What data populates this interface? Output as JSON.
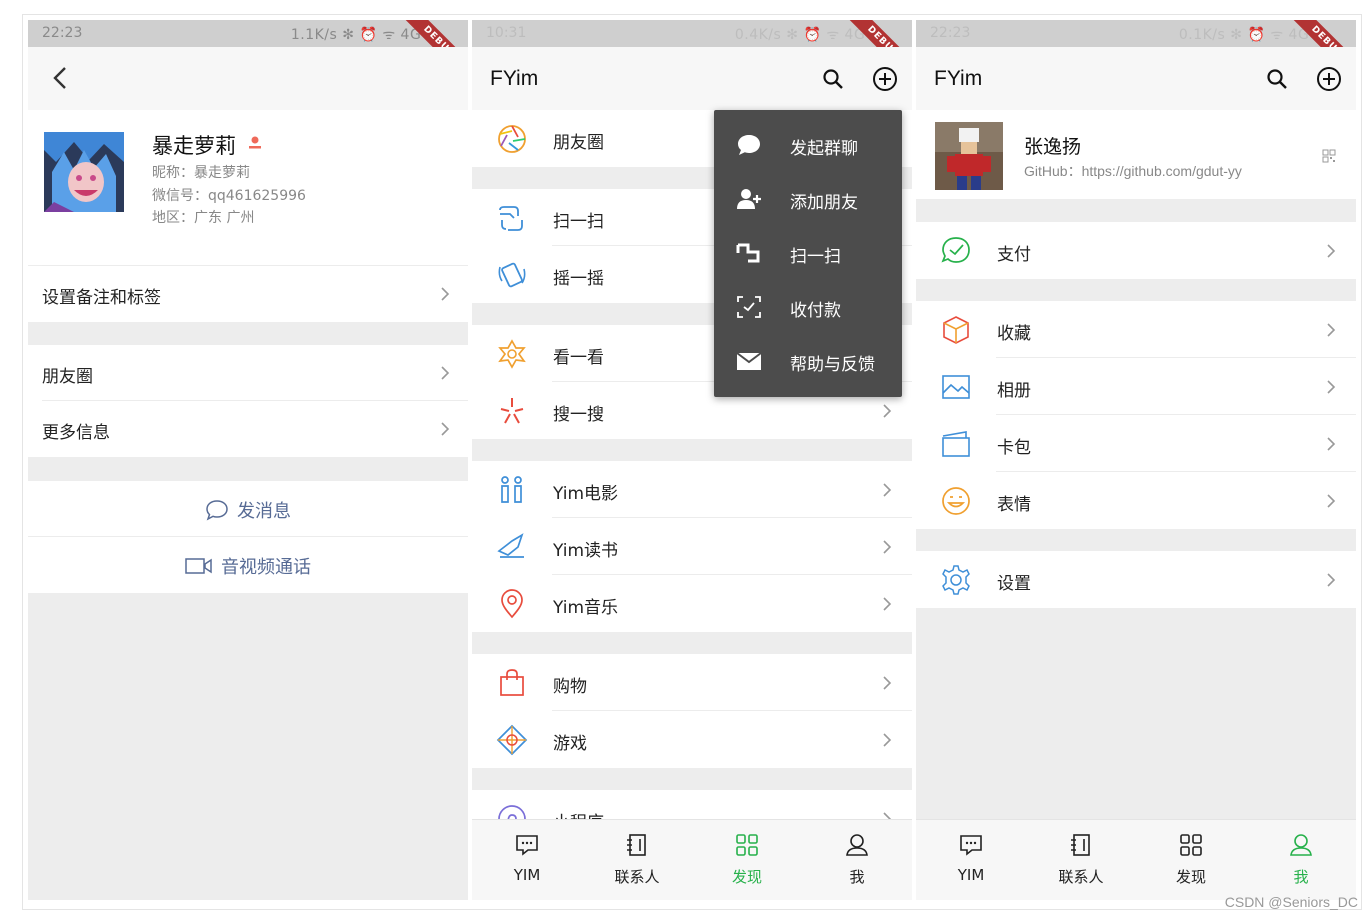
{
  "screen1": {
    "status_time": "22:23",
    "status_net": "1.1K/s ✻ ⏰ ᯤ 4G ▭",
    "debug_badge": "DEBUG",
    "profile": {
      "name": "暴走萝莉",
      "nickname": "昵称：暴走萝莉",
      "wechat_id": "微信号：qq461625996",
      "region": "地区：广东 广州"
    },
    "rows": {
      "remark": "设置备注和标签",
      "moments": "朋友圈",
      "more_info": "更多信息"
    },
    "actions": {
      "send_message": "发消息",
      "video_call": "音视频通话"
    }
  },
  "screen2": {
    "status_time": "10:31",
    "status_net": "0.4K/s ✻ ⏰ ᯤ 4G ▭",
    "debug_badge": "DEBUG",
    "app_title": "FYim",
    "items": {
      "moments": "朋友圈",
      "scan": "扫一扫",
      "shake": "摇一摇",
      "look": "看一看",
      "search": "搜一搜",
      "movie": "Yim电影",
      "books": "Yim读书",
      "music": "Yim音乐",
      "shopping": "购物",
      "games": "游戏",
      "mini_programs": "小程序"
    },
    "menu": {
      "group_chat": "发起群聊",
      "add_friend": "添加朋友",
      "scan": "扫一扫",
      "payment": "收付款",
      "help": "帮助与反馈"
    }
  },
  "screen3": {
    "status_time": "22:23",
    "status_net": "0.1K/s ✻ ⏰ ᯤ 4G ▭",
    "debug_badge": "DEBUG",
    "app_title": "FYim",
    "profile": {
      "name": "张逸扬",
      "github": "GitHub：https://github.com/gdut-yy"
    },
    "items": {
      "pay": "支付",
      "favorites": "收藏",
      "album": "相册",
      "cards": "卡包",
      "stickers": "表情",
      "settings": "设置"
    }
  },
  "tabs": {
    "chats": "YIM",
    "contacts": "联系人",
    "discover": "发现",
    "me": "我"
  },
  "colors": {
    "accent_green": "#27b14b",
    "link_blue": "#576b95",
    "menu_bg": "#4c4c4c",
    "debug_red": "#b23333"
  },
  "watermark": "CSDN @Seniors_DC"
}
